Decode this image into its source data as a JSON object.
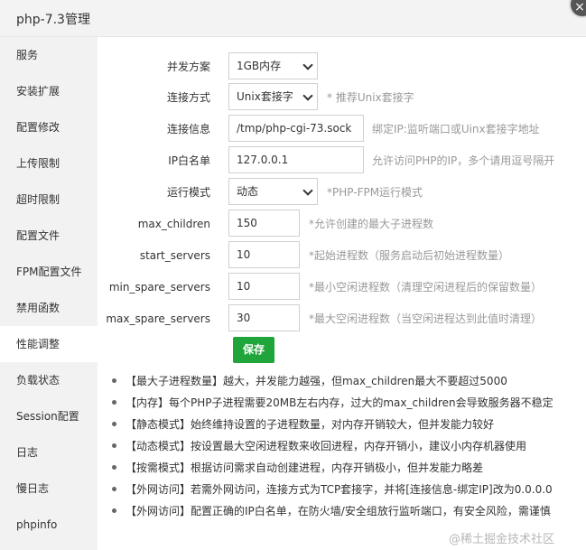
{
  "window": {
    "title": "php-7.3管理",
    "close_glyph": "×"
  },
  "sidebar": {
    "items": [
      {
        "label": "服务"
      },
      {
        "label": "安装扩展"
      },
      {
        "label": "配置修改"
      },
      {
        "label": "上传限制"
      },
      {
        "label": "超时限制"
      },
      {
        "label": "配置文件"
      },
      {
        "label": "FPM配置文件"
      },
      {
        "label": "禁用函数"
      },
      {
        "label": "性能调整",
        "active": true
      },
      {
        "label": "负载状态"
      },
      {
        "label": "Session配置"
      },
      {
        "label": "日志"
      },
      {
        "label": "慢日志"
      },
      {
        "label": "phpinfo"
      }
    ]
  },
  "form": {
    "concurrency": {
      "label": "并发方案",
      "value": "1GB内存"
    },
    "conn_mode": {
      "label": "连接方式",
      "value": "Unix套接字",
      "hint": "* 推荐Unix套接字"
    },
    "conn_info": {
      "label": "连接信息",
      "value": "/tmp/php-cgi-73.sock",
      "hint": "绑定IP:监听端口或Uinx套接字地址"
    },
    "ip_whitelist": {
      "label": "IP白名单",
      "value": "127.0.0.1",
      "hint": "允许访问PHP的IP，多个请用逗号隔开"
    },
    "run_mode": {
      "label": "运行模式",
      "value": "动态",
      "hint": "*PHP-FPM运行模式"
    },
    "max_children": {
      "label": "max_children",
      "value": "150",
      "hint": "*允许创建的最大子进程数"
    },
    "start_servers": {
      "label": "start_servers",
      "value": "10",
      "hint": "*起始进程数（服务启动后初始进程数量）"
    },
    "min_spare_servers": {
      "label": "min_spare_servers",
      "value": "10",
      "hint": "*最小空闲进程数（清理空闲进程后的保留数量）"
    },
    "max_spare_servers": {
      "label": "max_spare_servers",
      "value": "30",
      "hint": "*最大空闲进程数（当空闲进程达到此值时清理）"
    },
    "save_label": "保存"
  },
  "tips": [
    "【最大子进程数量】越大，并发能力越强，但max_children最大不要超过5000",
    "【内存】每个PHP子进程需要20MB左右内存，过大的max_children会导致服务器不稳定",
    "【静态模式】始终维持设置的子进程数量，对内存开销较大，但并发能力较好",
    "【动态模式】按设置最大空闲进程数来收回进程，内存开销小，建议小内存机器使用",
    "【按需模式】根据访问需求自动创建进程，内存开销极小，但并发能力略差",
    "【外网访问】若需外网访问，连接方式为TCP套接字，并将[连接信息-绑定IP]改为0.0.0.0",
    "【外网访问】配置正确的IP白名单，在防火墙/安全组放行监听端口，有安全风险，需谨慎"
  ],
  "watermark": "@稀土掘金技术社区",
  "colors": {
    "accent": "#20a53a",
    "sidebar_bg": "#f2f2f2",
    "hint_text": "#999999"
  }
}
